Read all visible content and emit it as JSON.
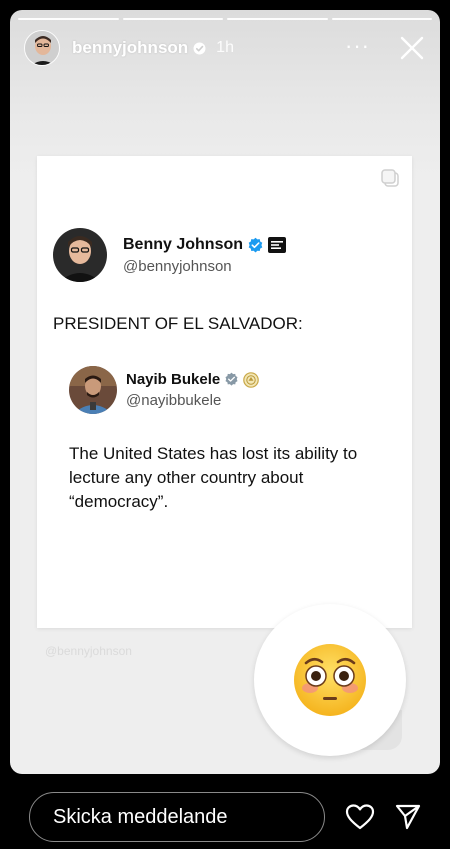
{
  "story": {
    "segments": 4,
    "username": "bennyjohnson",
    "time": "1h",
    "more_label": "···"
  },
  "post": {
    "author": {
      "name": "Benny Johnson",
      "handle": "@bennyjohnson"
    },
    "text": "PRESIDENT OF EL SALVADOR:",
    "quoted": {
      "name": "Nayib Bukele",
      "handle": "@nayibbukele",
      "text": "The United States has lost its ability to lecture any other country about “democracy”."
    }
  },
  "watermark": "@bennyjohnson",
  "sticker": {
    "emoji": "flushed-face-emoji"
  },
  "composer": {
    "placeholder": "Skicka meddelande"
  },
  "colors": {
    "verified": "#1d9bf0",
    "story_bg": "#eeeeee",
    "composer_border": "#8a8a8a"
  }
}
